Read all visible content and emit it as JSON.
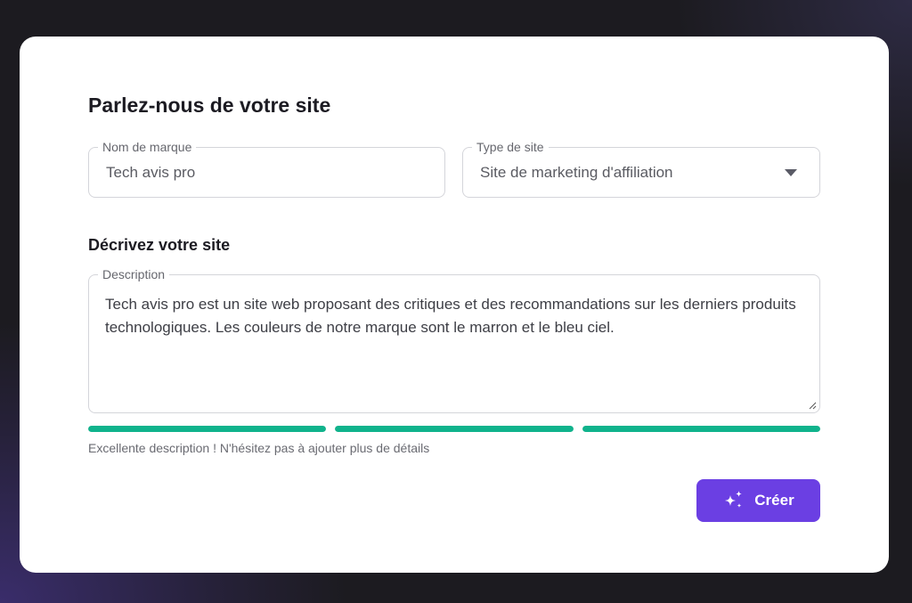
{
  "form": {
    "title": "Parlez-nous de votre site",
    "brand": {
      "label": "Nom de marque",
      "value": "Tech avis pro"
    },
    "site_type": {
      "label": "Type de site",
      "value": "Site de marketing d'affiliation",
      "icon": "chevron-down-icon"
    },
    "describe_heading": "Décrivez votre site",
    "description": {
      "label": "Description",
      "value": "Tech avis pro est un site web proposant des critiques et des recommandations sur les derniers produits technologiques. Les couleurs de notre marque sont le marron et le bleu ciel."
    },
    "quality": {
      "segments": [
        1,
        1,
        1
      ],
      "color": "#10b38c",
      "hint": "Excellente description ! N'hésitez pas à ajouter plus de détails"
    },
    "create_button": {
      "label": "Créer",
      "icon": "sparkle-icon",
      "color": "#6b3fe3"
    }
  }
}
